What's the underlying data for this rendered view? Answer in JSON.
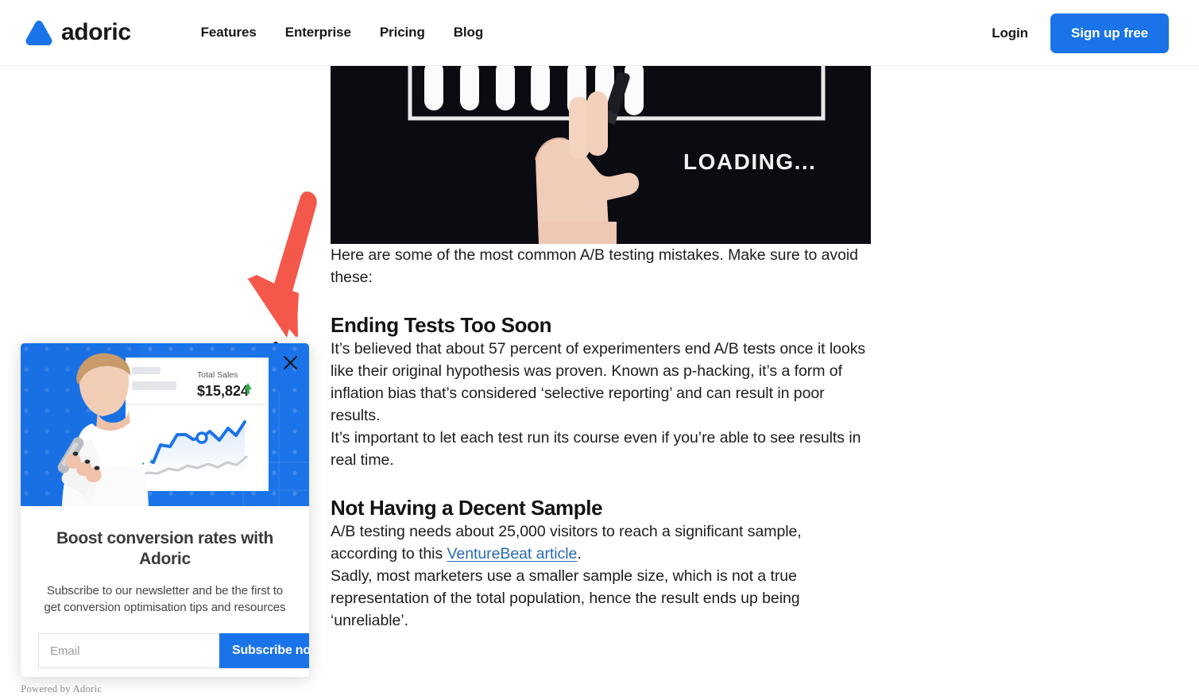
{
  "header": {
    "brand": {
      "name": "adoric",
      "logo_icon": "adoric-triangle-logo",
      "color": "#1a73e8"
    },
    "nav": [
      {
        "label": "Features"
      },
      {
        "label": "Enterprise"
      },
      {
        "label": "Pricing"
      },
      {
        "label": "Blog"
      }
    ],
    "login_label": "Login",
    "signup_label": "Sign up free",
    "signup_color": "#1a73e8"
  },
  "article": {
    "hero_image": {
      "alt": "hand drawing a loading progress bar on a dark background",
      "caption_text": "LOADING...",
      "background": "#0b0b12"
    },
    "intro": "Here are some of the most common A/B testing mistakes. Make sure to avoid these:",
    "heading_1": "Ending Tests Too Soon",
    "para_1": "It’s believed that about 57 percent of experimenters end A/B tests once it looks like their original hypothesis was proven. Known as p-hacking, it’s a form of inflation bias that’s considered ‘selective reporting’ and can result in poor results.",
    "para_2": "It’s important to let each test run its course even if you’re able to see results in real time.",
    "heading_2": "Not Having a Decent Sample",
    "para_3_before": "A/B testing needs about 25,000 visitors to reach a significant sample, according to this ",
    "para_3_link": "VentureBeat article",
    "para_3_after": ".",
    "link_color": "#2a6bb5",
    "para_4": "Sadly, most marketers use a smaller sample size, which is not a true representation of the total population, hence the result ends up being ‘unreliable’."
  },
  "annotation": {
    "arrow_icon": "red-down-left-arrow",
    "color": "#f4584a"
  },
  "popup": {
    "close_icon": "close-x-icon",
    "hero": {
      "background_color": "#1a73e8",
      "image_alt": "woman looking at phone next to a sales dashboard card",
      "card_label": "Total Sales",
      "card_value": "$15,824",
      "trend_icon": "up-arrow-icon",
      "trend_color": "#2fa84f",
      "line_color": "#1a73e8"
    },
    "title": "Boost conversion rates with Adoric",
    "subtitle": "Subscribe to our newsletter and be the first to get conversion optimisation tips and resources",
    "email_placeholder": "Email",
    "email_value": "",
    "submit_label": "Subscribe now",
    "submit_color": "#1a73e8",
    "powered_by": "Powered by Adoric"
  }
}
